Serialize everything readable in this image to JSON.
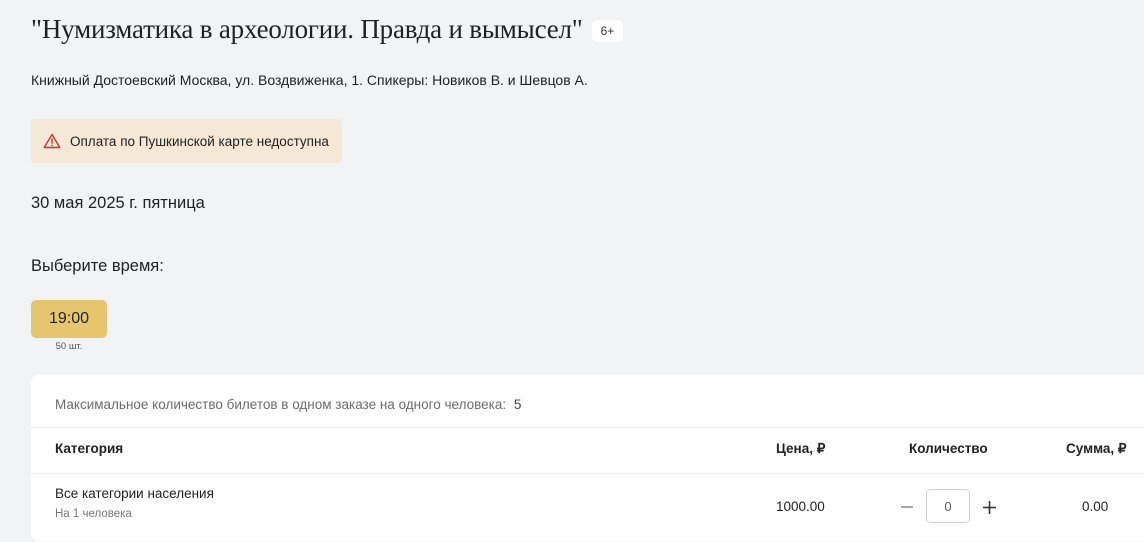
{
  "event": {
    "title": "\"Нумизматика в археологии. Правда и вымысел\"",
    "age_rating": "6+",
    "venue": "Книжный Достоевский Москва, ул. Воздвиженка, 1. Спикеры: Новиков В. и Шевцов А.",
    "warning": "Оплата по Пушкинской карте недоступна",
    "date": "30 мая 2025 г. пятница"
  },
  "time_selection": {
    "label": "Выберите время:",
    "slots": [
      {
        "time": "19:00",
        "available": "50 шт.",
        "selected": true
      }
    ]
  },
  "tickets": {
    "max_info_label": "Максимальное количество билетов в одном заказе на одного человека:",
    "max_info_value": "5",
    "columns": {
      "category": "Категория",
      "price": "Цена, ₽",
      "quantity": "Количество",
      "sum": "Сумма, ₽"
    },
    "rows": [
      {
        "category": "Все категории населения",
        "subtitle": "На 1 человека",
        "price": "1000.00",
        "quantity": "0",
        "sum": "0.00"
      }
    ]
  },
  "colors": {
    "background": "#f2f3f5",
    "warning_bg": "#f5e8d6",
    "warning_icon": "#c0392b",
    "selected_slot": "#e5c56d",
    "card_bg": "#ffffff"
  },
  "icons": {
    "warning": "warning-triangle-icon",
    "minus": "minus-icon",
    "plus": "plus-icon"
  }
}
